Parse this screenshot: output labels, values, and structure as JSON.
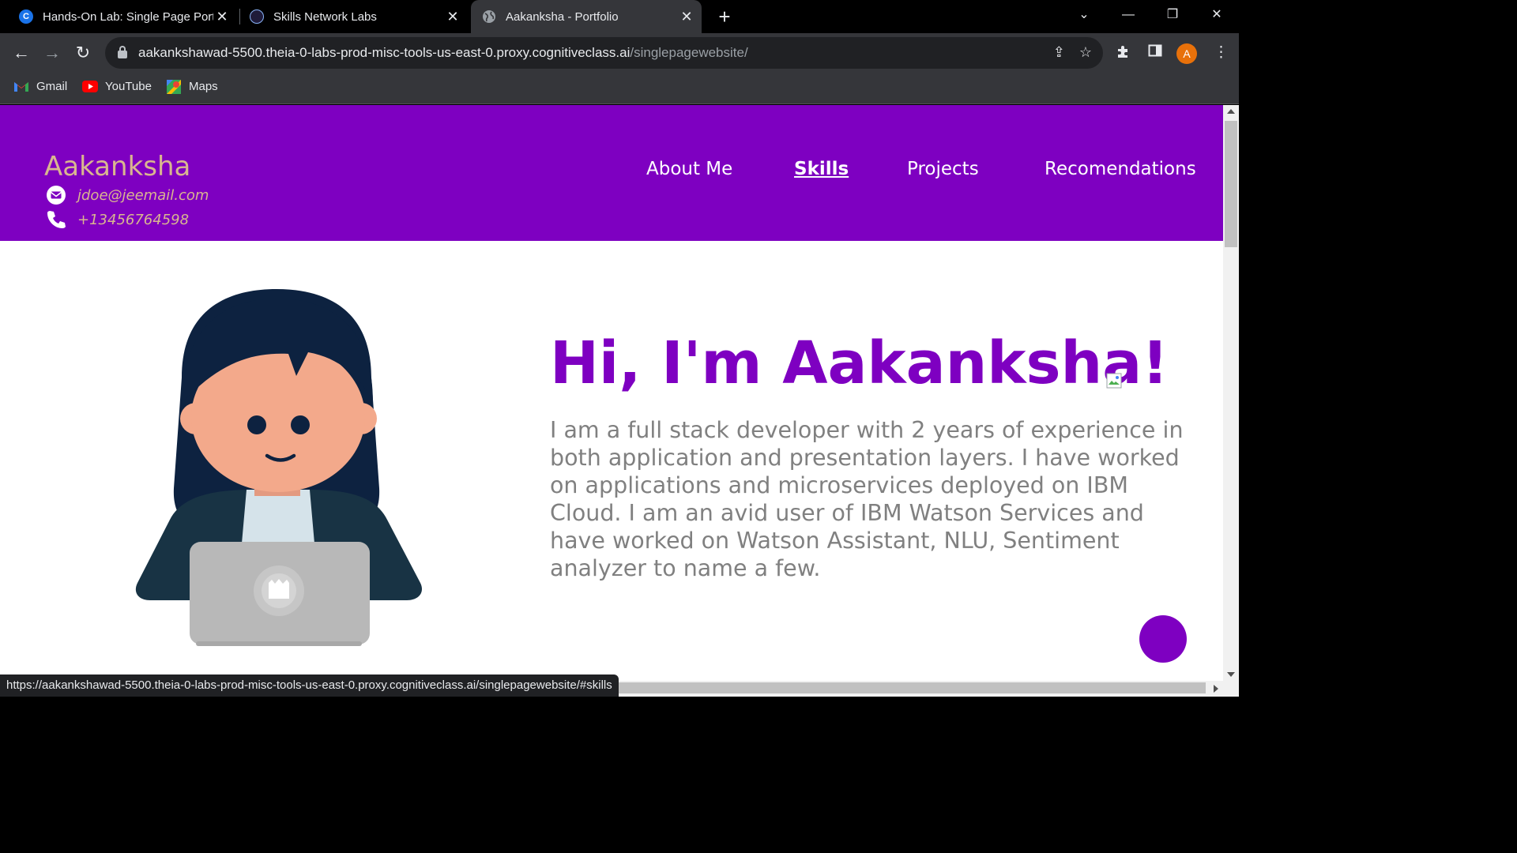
{
  "browser": {
    "tabs": [
      {
        "title": "Hands-On Lab: Single Page Portfolio",
        "active": false
      },
      {
        "title": "Skills Network Labs",
        "active": false
      },
      {
        "title": "Aakanksha - Portfolio",
        "active": true
      }
    ],
    "url_host": "aakankshawad-5500.theia-0-labs-prod-misc-tools-us-east-0.proxy.cognitiveclass.ai",
    "url_path": "/singlepagewebsite/",
    "profile_initial": "A",
    "bookmarks": [
      {
        "label": "Gmail"
      },
      {
        "label": "YouTube"
      },
      {
        "label": "Maps"
      }
    ],
    "status_url": "https://aakankshawad-5500.theia-0-labs-prod-misc-tools-us-east-0.proxy.cognitiveclass.ai/singlepagewebsite/#skills"
  },
  "page": {
    "brand": "Aakanksha",
    "email": "jdoe@jeemail.com",
    "phone": "+13456764598",
    "nav": [
      {
        "label": "About Me"
      },
      {
        "label": "Skills",
        "active": true
      },
      {
        "label": "Projects"
      },
      {
        "label": "Recomendations"
      }
    ],
    "hero_title": "Hi, I'm Aakanksha!",
    "hero_text": "I am a full stack developer with 2 years of experience in both application and presentation layers. I have worked on applications and microservices deployed on IBM Cloud. I am an avid user of IBM Watson Services and have worked on Watson Assistant, NLU, Sentiment analyzer to name a few."
  },
  "colors": {
    "header_bg": "#7e00c1",
    "brand_text": "#d9b68f",
    "hero_title": "#7e00c1",
    "hero_text": "#808080"
  }
}
